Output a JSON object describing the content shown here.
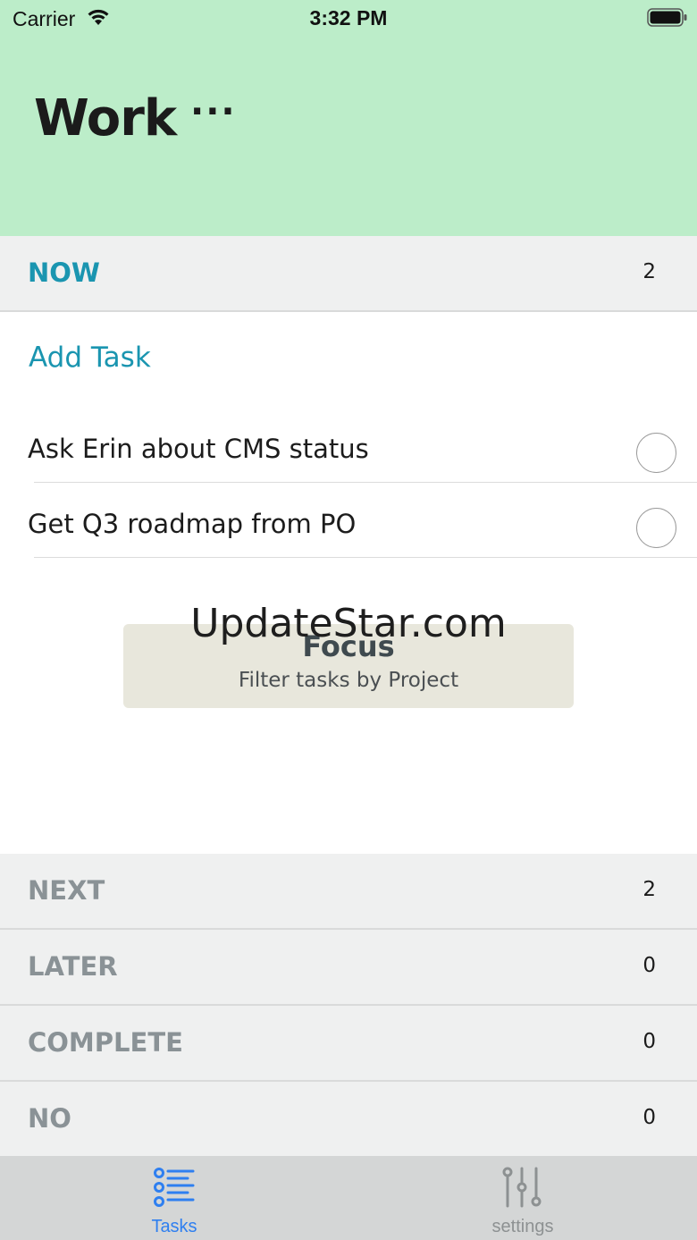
{
  "status_bar": {
    "carrier": "Carrier",
    "time": "3:32 PM"
  },
  "header": {
    "title": "Work",
    "more_label": "···"
  },
  "sections": {
    "now": {
      "label": "NOW",
      "count": "2"
    },
    "next": {
      "label": "NEXT",
      "count": "2"
    },
    "later": {
      "label": "LATER",
      "count": "0"
    },
    "complete": {
      "label": "COMPLETE",
      "count": "0"
    },
    "no": {
      "label": "NO",
      "count": "0"
    }
  },
  "add_task_label": "Add Task",
  "tasks": [
    {
      "label": "Ask Erin about CMS status"
    },
    {
      "label": "Get Q3 roadmap from PO"
    }
  ],
  "focus": {
    "title": "Focus",
    "subtitle": "Filter tasks by Project"
  },
  "watermark": "UpdateStar.com",
  "tabbar": {
    "tasks": {
      "label": "Tasks",
      "icon": "list-icon"
    },
    "settings": {
      "label": "settings",
      "icon": "sliders-icon"
    }
  },
  "colors": {
    "header_bg": "#bcedc9",
    "accent": "#1a95b0",
    "tab_active": "#2e7ff0",
    "section_bg": "#eff0f0"
  }
}
